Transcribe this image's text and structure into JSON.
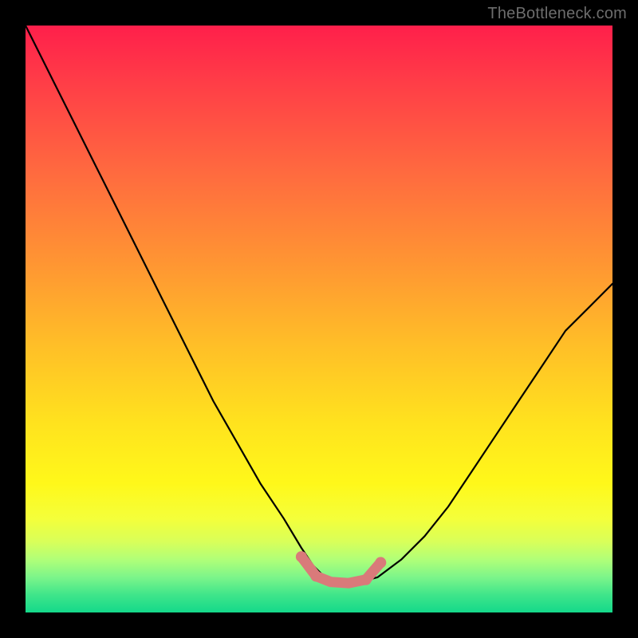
{
  "watermark": "TheBottleneck.com",
  "colors": {
    "frame": "#000000",
    "gradient_top": "#ff1f4b",
    "gradient_mid": "#ffe31e",
    "gradient_bottom": "#14d98a",
    "curve_stroke": "#000000",
    "accent_pink": "#d97a7a"
  },
  "chart_data": {
    "type": "line",
    "title": "",
    "xlabel": "",
    "ylabel": "",
    "xlim": [
      0,
      100
    ],
    "ylim": [
      0,
      100
    ],
    "series": [
      {
        "name": "bottleneck-curve",
        "x": [
          0,
          2,
          5,
          8,
          12,
          16,
          20,
          24,
          28,
          32,
          36,
          40,
          44,
          47,
          49,
          51,
          53,
          55,
          57,
          60,
          64,
          68,
          72,
          76,
          80,
          84,
          88,
          92,
          96,
          100
        ],
        "y": [
          100,
          96,
          90,
          84,
          76,
          68,
          60,
          52,
          44,
          36,
          29,
          22,
          16,
          11,
          8,
          6,
          5.2,
          5,
          5.2,
          6,
          9,
          13,
          18,
          24,
          30,
          36,
          42,
          48,
          52,
          56
        ]
      }
    ],
    "highlight": {
      "name": "bottom-accent",
      "x": [
        47,
        49.5,
        52,
        55,
        58,
        60.5
      ],
      "y": [
        9.5,
        6.2,
        5.2,
        5.0,
        5.6,
        8.5
      ]
    }
  }
}
